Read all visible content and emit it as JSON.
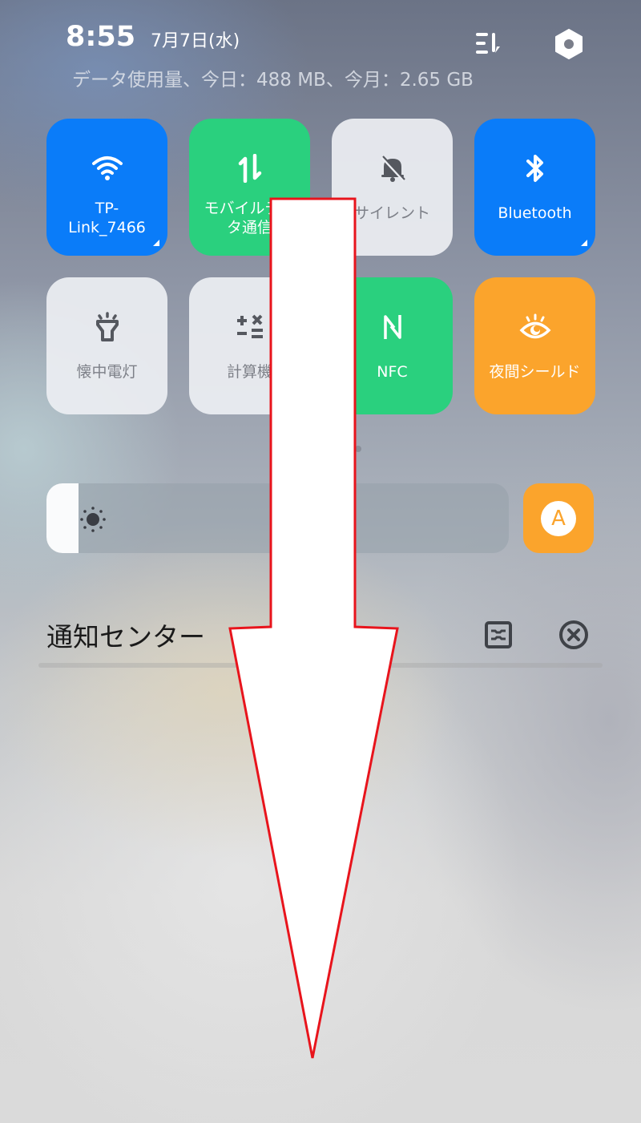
{
  "status": {
    "time": "8:55",
    "date": "7月7日(水)",
    "data_usage": "データ使用量、今日：488 MB、今月：2.65 GB"
  },
  "header_icons": [
    {
      "name": "sort-icon"
    },
    {
      "name": "settings-icon"
    }
  ],
  "tiles": [
    {
      "id": "wifi",
      "label": "TP-\nLink_7466",
      "icon": "wifi-icon",
      "state": "on",
      "color": "#0a7cf9",
      "has_corner": true
    },
    {
      "id": "mobile-data",
      "label": "モバイルデータ通信",
      "icon": "data-transfer-icon",
      "state": "on",
      "color": "#2ad07e",
      "has_corner": false
    },
    {
      "id": "silent",
      "label": "サイレント",
      "icon": "bell-off-icon",
      "state": "off",
      "color": "#eceef2",
      "has_corner": false
    },
    {
      "id": "bluetooth",
      "label": "Bluetooth",
      "icon": "bluetooth-icon",
      "state": "on",
      "color": "#0a7cf9",
      "has_corner": true
    },
    {
      "id": "flashlight",
      "label": "懐中電灯",
      "icon": "flashlight-icon",
      "state": "off",
      "color": "#eceef2",
      "has_corner": false
    },
    {
      "id": "calculator",
      "label": "計算機",
      "icon": "calculator-icon",
      "state": "off",
      "color": "#eceef2",
      "has_corner": false
    },
    {
      "id": "nfc",
      "label": "NFC",
      "icon": "nfc-icon",
      "state": "on",
      "color": "#2ad07e",
      "has_corner": false
    },
    {
      "id": "night-shield",
      "label": "夜間シールド",
      "icon": "eye-icon",
      "state": "on",
      "color": "#fba42c",
      "has_corner": false
    }
  ],
  "brightness": {
    "level_percent": 7,
    "icon": "sun-icon",
    "auto_label": "A",
    "auto_color": "#fba42c"
  },
  "notification_center": {
    "title": "通知センター",
    "actions": [
      {
        "name": "manage-notifications-icon"
      },
      {
        "name": "clear-all-icon"
      }
    ]
  },
  "annotation": {
    "type": "swipe-down-arrow",
    "fill": "#ffffff",
    "stroke": "#e8141c"
  }
}
